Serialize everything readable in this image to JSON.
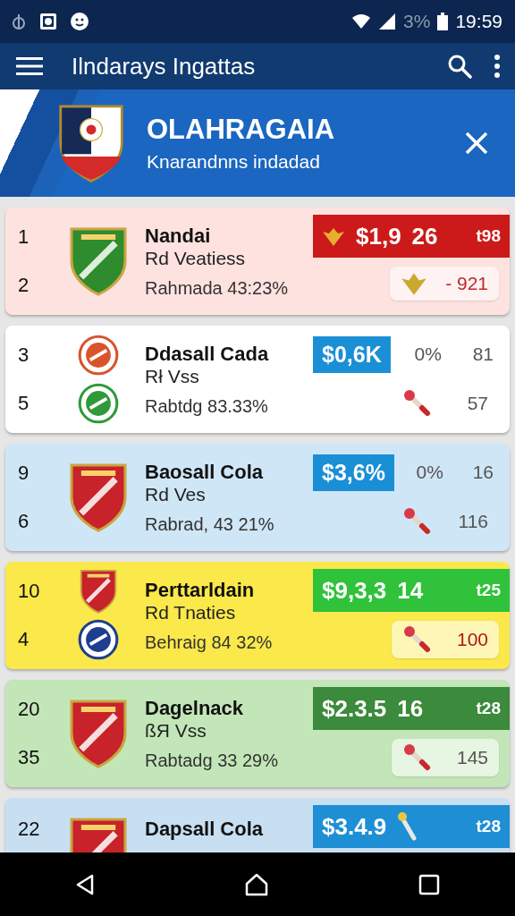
{
  "status_bar": {
    "battery": "3%",
    "time": "19:59"
  },
  "app_bar": {
    "title": "Ilndarays Ingattas"
  },
  "banner": {
    "title": "OLAHRAGAIA",
    "subtitle": "Knarandnns indadad"
  },
  "cards": [
    {
      "color": "#fde2df",
      "ranks": [
        "1",
        "2"
      ],
      "crests": [
        {
          "kind": "shield",
          "color": "#2e8b2e"
        }
      ],
      "name": "Nandai",
      "subtitle": "Rd Veatiess",
      "stat": "Rahmada 43:23%",
      "badge": {
        "kind": "wide",
        "color": "#cc1a1a",
        "price": "$1,9",
        "items": [
          {
            "kind": "emblem"
          },
          {
            "kind": "text",
            "text": "26"
          },
          {
            "kind": "small_text",
            "text": "t98"
          }
        ]
      },
      "bottom": {
        "chip": true,
        "items": [
          {
            "kind": "emblem"
          },
          {
            "kind": "text",
            "text": "- 921",
            "color": "#c0282d"
          }
        ]
      }
    },
    {
      "color": "#ffffff",
      "ranks": [
        "3",
        "5"
      ],
      "crests": [
        {
          "kind": "round",
          "color": "#d9542b"
        },
        {
          "kind": "round",
          "color": "#2f9a3a"
        }
      ],
      "name": "Ddasall Cada",
      "subtitle": "Rł Vss",
      "stat": "Rabtdg 83.33%",
      "badge": {
        "kind": "small",
        "color": "#1b8fd6",
        "price": "$0,6K",
        "items": [
          {
            "kind": "text",
            "text": "0%"
          },
          {
            "kind": "text",
            "text": "81"
          }
        ]
      },
      "bottom": {
        "chip": false,
        "items": [
          {
            "kind": "torch"
          },
          {
            "kind": "text",
            "text": "57",
            "color": "#555555"
          }
        ]
      }
    },
    {
      "color": "#cfe6f6",
      "ranks": [
        "9",
        "6"
      ],
      "crests": [
        {
          "kind": "shield",
          "color": "#c8222a"
        }
      ],
      "name": "Baosall Cola",
      "subtitle": "Rd Ves",
      "stat": "Rabrad, 43 21%",
      "badge": {
        "kind": "small",
        "color": "#1b8fd6",
        "price": "$3,6%",
        "items": [
          {
            "kind": "text",
            "text": "0%"
          },
          {
            "kind": "text",
            "text": "16"
          }
        ]
      },
      "bottom": {
        "chip": false,
        "items": [
          {
            "kind": "torch"
          },
          {
            "kind": "text",
            "text": "116",
            "color": "#555555"
          }
        ]
      }
    },
    {
      "color": "#fbe84a",
      "ranks": [
        "10",
        "4"
      ],
      "crests": [
        {
          "kind": "shield",
          "color": "#c8222a"
        },
        {
          "kind": "round",
          "color": "#1d3f8f"
        }
      ],
      "name": "Perttarldain",
      "subtitle": "Rd Tnaties",
      "stat": "Behraig 84 32%",
      "badge": {
        "kind": "wide",
        "color": "#2fc23a",
        "price": "$9,3,3",
        "items": [
          {
            "kind": "text",
            "text": "14"
          },
          {
            "kind": "small_text",
            "text": "t25"
          }
        ]
      },
      "bottom": {
        "chip": true,
        "items": [
          {
            "kind": "torch"
          },
          {
            "kind": "text",
            "text": "100",
            "color": "#b0171c"
          }
        ]
      }
    },
    {
      "color": "#c2e6b8",
      "ranks": [
        "20",
        "35"
      ],
      "crests": [
        {
          "kind": "shield",
          "color": "#c8222a"
        }
      ],
      "name": "Dagelnack",
      "subtitle": "ßЯ Vss",
      "stat": "Rabtadg 33 29%",
      "badge": {
        "kind": "wide",
        "color": "#3c8a3c",
        "price": "$2.3.5",
        "items": [
          {
            "kind": "text",
            "text": "16"
          },
          {
            "kind": "small_text",
            "text": "t28"
          }
        ]
      },
      "bottom": {
        "chip": true,
        "items": [
          {
            "kind": "torch"
          },
          {
            "kind": "text",
            "text": "145",
            "color": "#555555"
          }
        ]
      }
    },
    {
      "color": "#c8dff2",
      "ranks": [
        "22"
      ],
      "crests": [
        {
          "kind": "shield",
          "color": "#c8222a"
        }
      ],
      "name": "Dapsall Cola",
      "badge": {
        "kind": "wide",
        "color": "#1e8fd4",
        "price": "$3.4.9",
        "items": [
          {
            "kind": "torch"
          },
          {
            "kind": "small_text",
            "text": "t28"
          }
        ]
      }
    }
  ]
}
